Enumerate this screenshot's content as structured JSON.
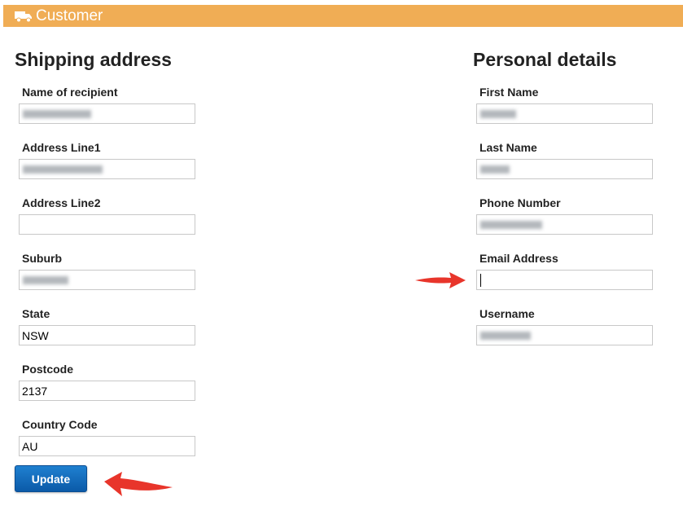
{
  "header": {
    "title": "Customer",
    "icon": "truck-icon",
    "color": "#f0ad55"
  },
  "shipping": {
    "title": "Shipping address",
    "fields": {
      "recipient": {
        "label": "Name of recipient",
        "value": ""
      },
      "address1": {
        "label": "Address Line1",
        "value": ""
      },
      "address2": {
        "label": "Address Line2",
        "value": ""
      },
      "suburb": {
        "label": "Suburb",
        "value": ""
      },
      "state": {
        "label": "State",
        "value": "NSW"
      },
      "postcode": {
        "label": "Postcode",
        "value": "2137"
      },
      "country": {
        "label": "Country Code",
        "value": "AU"
      }
    },
    "update_label": "Update"
  },
  "personal": {
    "title": "Personal details",
    "fields": {
      "first_name": {
        "label": "First Name",
        "value": ""
      },
      "last_name": {
        "label": "Last Name",
        "value": ""
      },
      "phone": {
        "label": "Phone Number",
        "value": ""
      },
      "email": {
        "label": "Email Address",
        "value": ""
      },
      "username": {
        "label": "Username",
        "value": ""
      }
    }
  },
  "annotations": {
    "arrow_color": "#e8352b",
    "arrows": [
      "arrow-pointing-to-email-field",
      "arrow-pointing-to-update-button"
    ]
  }
}
